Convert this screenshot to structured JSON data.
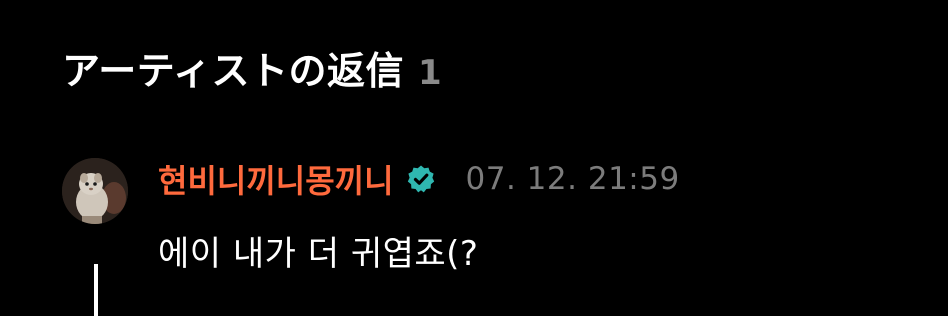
{
  "section": {
    "title": "アーティストの返信",
    "count": "1"
  },
  "comment": {
    "author": "현비니끼니몽끼니",
    "verified_icon": "verified-check-icon",
    "timestamp": "07. 12. 21:59",
    "text": "에이 내가 더 귀엽죠(?",
    "avatar_icon": "user-avatar-photo"
  },
  "colors": {
    "background": "#000000",
    "author": "#ff6a3d",
    "verified_badge": "#2fb7b0",
    "timestamp": "#7c7c7c",
    "count": "#8a8a8a",
    "text": "#ffffff"
  }
}
